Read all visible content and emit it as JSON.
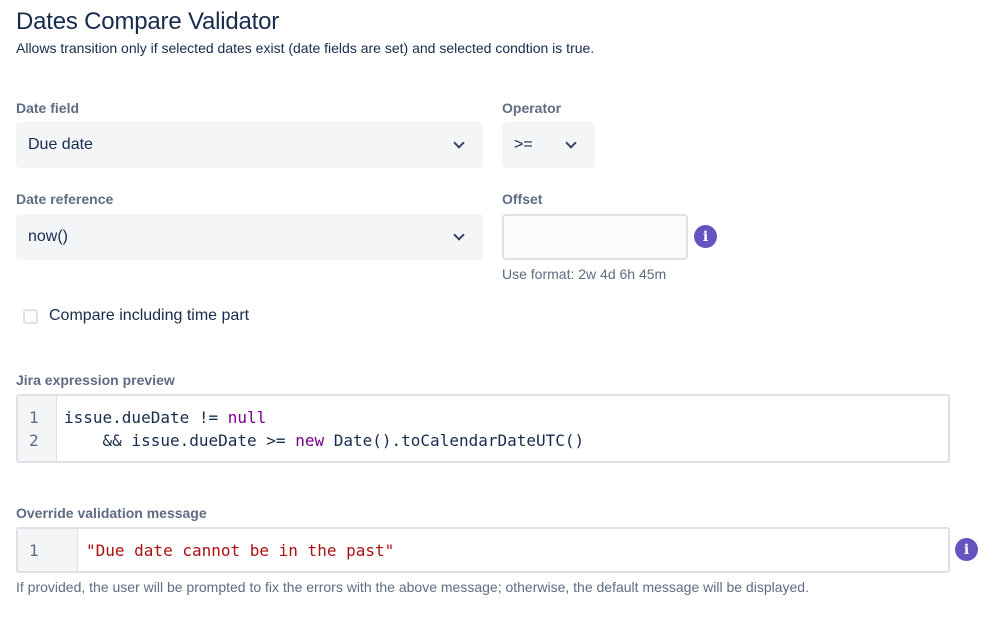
{
  "header": {
    "title": "Dates Compare Validator",
    "description": "Allows transition only if selected dates exist (date fields are set) and selected condtion is true."
  },
  "date_field": {
    "label": "Date field",
    "value": "Due date"
  },
  "operator": {
    "label": "Operator",
    "value": ">="
  },
  "date_reference": {
    "label": "Date reference",
    "value": "now()"
  },
  "offset": {
    "label": "Offset",
    "value": "",
    "placeholder": "",
    "help": "Use format: 2w 4d 6h 45m"
  },
  "compare_time": {
    "label": "Compare including time part",
    "checked": false
  },
  "expression_preview": {
    "label": "Jira expression preview",
    "lines": [
      {
        "number": "1",
        "p1": "issue.dueDate != ",
        "kw1": "null",
        "p2": "",
        "kw2": "",
        "p3": ""
      },
      {
        "number": "2",
        "p1": "    && issue.dueDate >= ",
        "kw1": "new",
        "p2": " Date().toCalendarDateUTC()",
        "kw2": "",
        "p3": ""
      }
    ]
  },
  "override_message": {
    "label": "Override validation message",
    "line_number": "1",
    "value": "\"Due date cannot be in the past\"",
    "help": "If provided, the user will be prompted to fix the errors with the above message; otherwise, the default message will be displayed."
  },
  "icons": {
    "info": "info-icon",
    "chevron": "chevron-down-icon"
  },
  "colors": {
    "info_accent": "#6554c0",
    "keyword": "#770088",
    "string": "#aa1111",
    "text": "#172b4d",
    "label": "#5e6c84"
  }
}
